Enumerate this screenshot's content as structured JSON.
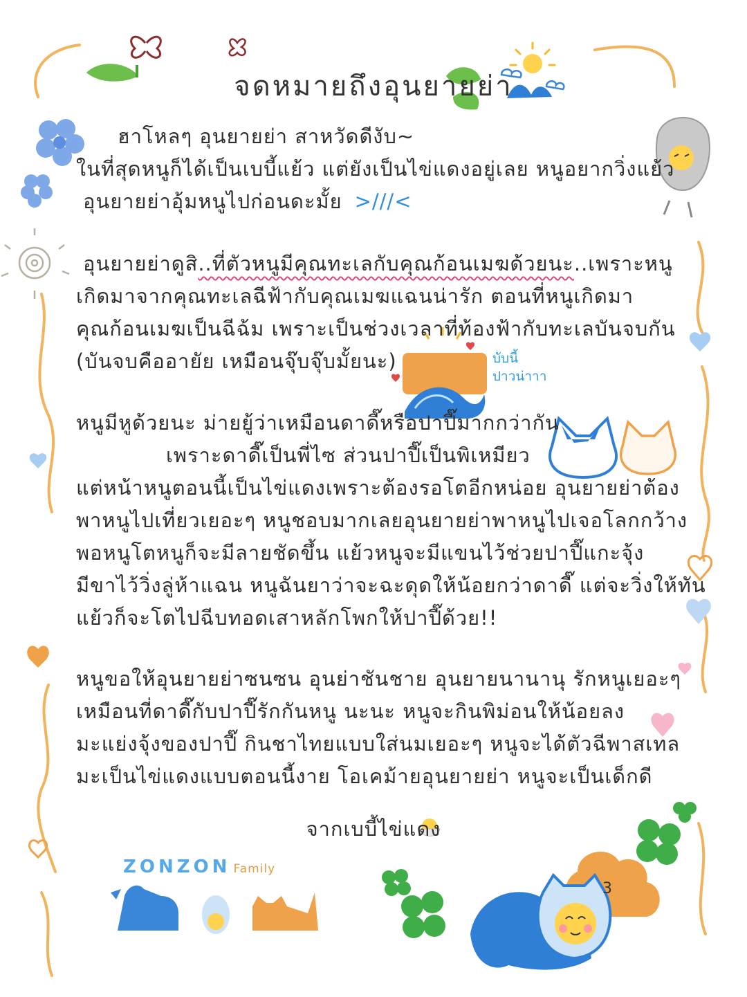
{
  "letter": {
    "title": "จดหมายถึงอุนยายย่า",
    "greeting": {
      "line1": "ฮาโหลๆ อุนยายย่า สาหวัดดีงับ~",
      "line2": "ในที่สุดหนูก็ได้เป็นเบบี้แย้ว แต่ยังเป็นไข่แดงอยู่เลย หนูอยากวิ่งแย้ว",
      "line3": "อุนยายย่าอุ้มหนูไปก่อนดะมั้ย",
      "face": ">///<"
    },
    "para2": {
      "line1_start": "อุนยายย่าดูสิ",
      "line1_wavy": "..ที่ตัวหนูมีคุณทะเลกับคุณก้อนเมฆด้วยนะ",
      "line1_end": "..เพราะหนู",
      "line2": "เกิดมาจากคุณทะเลฉีฟ้ากับคุณเมฆแฉนน่ารัก ตอนที่หนูเกิดมา",
      "line3": "คุณก้อนเมฆเป็นฉีฉ้ม เพราะเป็นช่วงเวลาที่ท้องฟ้ากับทะเลบันจบกัน",
      "line4": "(บันจบคืออายัย เหมือนจุ๊บจุ๊บมั้ยนะ)"
    },
    "sticker_note": {
      "line1": "บับนี้",
      "line2": "ปาวน่าาา"
    },
    "para3": {
      "line1": "หนูมีหูด้วยนะ ม่ายยู้ว่าเหมือนดาดี๊หรือปาปี๊มากกว่ากัน",
      "line2": "เพราะดาดี๊เป็นพี่ไซ ส่วนปาปี๊เป็นพิเหมียว",
      "line3": "แต่หน้าหนูตอนนี้เป็นไข่แดงเพราะต้องรอโตอีกหน่อย อุนยายย่าต้อง",
      "line4": "พาหนูไปเที่ยวเยอะๆ หนูชอบมากเลยอุนยายย่าพาหนูไปเจอโลกกว้าง",
      "line5": "พอหนูโตหนูก็จะมีลายชัดขึ้น แย้วหนูจะมีแขนไว้ช่วยปาปี๊แกะจุ้ง",
      "line6": "มีขาไว้วิ่งลู่ห้าแฉน หนูฉันยาว่าจะฉะดุดให้น้อยกว่าดาดี๊ แต่จะวิ่งให้ทัน",
      "line7": "แย้วก็จะโตไปฉีบทอดเสาหลักโพกให้ปาปี๊ด้วย!!"
    },
    "para4": {
      "line1": "หนูขอให้อุนยายย่าซนซน อุนย่าชันชาย อุนยายนานานุ รักหนูเยอะๆ",
      "line2": "เหมือนที่ดาดี๊กับปาปี๊รักกันหนู นะนะ หนูจะกินพิม่อนให้น้อยลง",
      "line3": "มะแย่งจุ้งของปาปี๊ กินชาไทยแบบใส่นมเยอะๆ หนูจะได้ตัวฉีพาสเทล",
      "line4": "มะเป็นไข่แดงแบบตอนนี้งาย โอเคม้ายอุนยายย่า หนูจะเป็นเด็กดี"
    },
    "signature": "จากเบบี้ไข่แดง",
    "brand": {
      "name": "ZONZON",
      "sub": "Family"
    },
    "kiss": "3"
  },
  "colors": {
    "blue": "#3a86d8",
    "light_blue": "#9cc7f0",
    "orange": "#f0a24a",
    "green": "#4caf50",
    "pink": "#e0447a",
    "crayon_orange_line": "#f2b35e"
  }
}
